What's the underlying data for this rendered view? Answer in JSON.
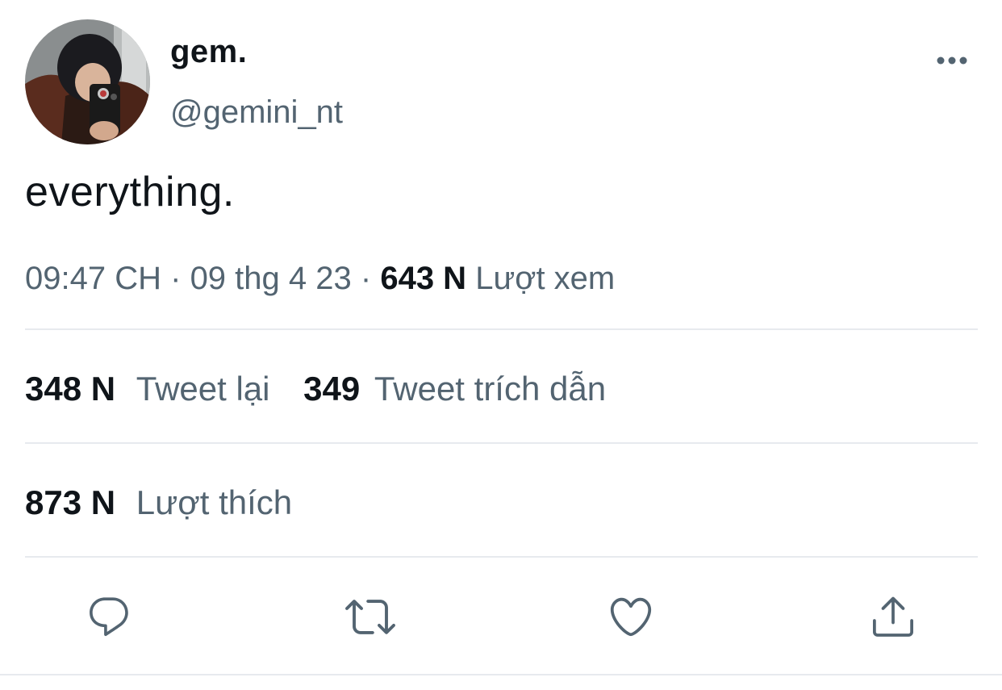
{
  "author": {
    "display_name": "gem.",
    "handle": "@gemini_nt"
  },
  "tweet": {
    "text": "everything."
  },
  "meta": {
    "time": "09:47 CH",
    "separator": "·",
    "date": "09 thg 4 23",
    "views_count": "643 N",
    "views_label": "Lượt xem"
  },
  "stats": {
    "retweets_count": "348 N",
    "retweets_label": "Tweet lại",
    "quotes_count": "349",
    "quotes_label": "Tweet trích dẫn",
    "likes_count": "873 N",
    "likes_label": "Lượt thích"
  },
  "icons": {
    "more": "more-horizontal-icon",
    "reply": "reply-icon",
    "retweet": "retweet-icon",
    "like": "heart-icon",
    "share": "share-icon"
  },
  "colors": {
    "text_primary": "#0f1419",
    "text_secondary": "#536471",
    "divider": "#e7eaee"
  }
}
